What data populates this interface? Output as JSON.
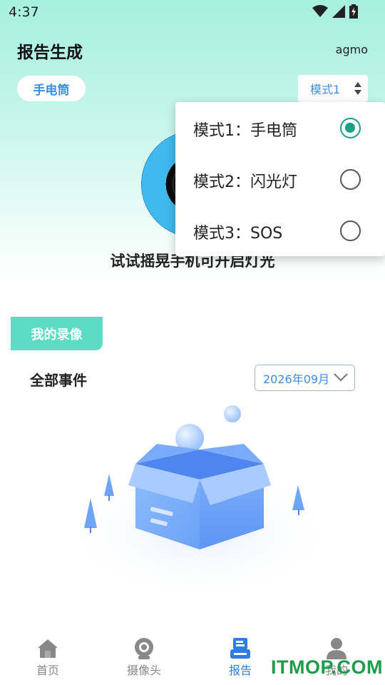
{
  "status_bar": {
    "time": "4:37"
  },
  "header": {
    "title": "报告生成",
    "user": "agmo"
  },
  "flashlight": {
    "mode_pill": "手电筒",
    "mode_select": "模式1",
    "hint": "试试摇晃手机可开启灯光"
  },
  "mode_dropdown": {
    "options": [
      {
        "label": "模式1：手电筒",
        "selected": true
      },
      {
        "label": "模式2：闪光灯",
        "selected": false
      },
      {
        "label": "模式3：SOS",
        "selected": false
      }
    ]
  },
  "recordings": {
    "tab_label": "我的录像",
    "events_title": "全部事件",
    "month_select": "2026年09月"
  },
  "bottom_nav": {
    "items": [
      {
        "label": "首页",
        "icon": "home-icon",
        "active": false
      },
      {
        "label": "摄像头",
        "icon": "camera-icon",
        "active": false
      },
      {
        "label": "报告",
        "icon": "report-icon",
        "active": true
      },
      {
        "label": "我的",
        "icon": "user-icon",
        "active": false
      }
    ]
  },
  "watermark": "ITMOP.COM",
  "colors": {
    "accent_blue": "#3a8ee6",
    "accent_teal": "#5ddbc5",
    "radio_selected": "#1aa089",
    "nav_active": "#2e7de0",
    "watermark_green": "#1e9c4a"
  }
}
